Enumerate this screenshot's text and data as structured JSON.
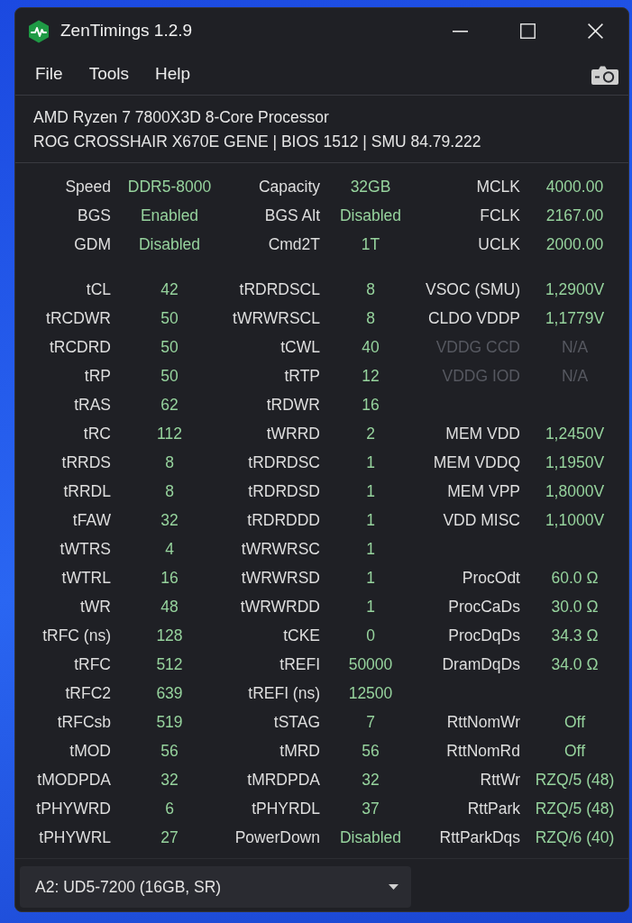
{
  "window": {
    "title": "ZenTimings 1.2.9"
  },
  "menu": [
    "File",
    "Tools",
    "Help"
  ],
  "system_info": {
    "processor": "AMD Ryzen 7 7800X3D 8-Core Processor",
    "board": "ROG CROSSHAIR X670E GENE | BIOS 1512 | SMU 84.79.222"
  },
  "sections": [
    {
      "rows": [
        [
          {
            "label": "Speed",
            "value": "DDR5-8000",
            "disabled": false
          },
          {
            "label": "Capacity",
            "value": "32GB",
            "disabled": false
          },
          {
            "label": "MCLK",
            "value": "4000.00",
            "disabled": false
          }
        ],
        [
          {
            "label": "BGS",
            "value": "Enabled",
            "disabled": false
          },
          {
            "label": "BGS Alt",
            "value": "Disabled",
            "disabled": false
          },
          {
            "label": "FCLK",
            "value": "2167.00",
            "disabled": false
          }
        ],
        [
          {
            "label": "GDM",
            "value": "Disabled",
            "disabled": false
          },
          {
            "label": "Cmd2T",
            "value": "1T",
            "disabled": false
          },
          {
            "label": "UCLK",
            "value": "2000.00",
            "disabled": false
          }
        ]
      ]
    },
    {
      "rows": [
        [
          {
            "label": "tCL",
            "value": "42",
            "disabled": false
          },
          {
            "label": "tRDRDSCL",
            "value": "8",
            "disabled": false
          },
          {
            "label": "VSOC (SMU)",
            "value": "1,2900V",
            "disabled": false
          }
        ],
        [
          {
            "label": "tRCDWR",
            "value": "50",
            "disabled": false
          },
          {
            "label": "tWRWRSCL",
            "value": "8",
            "disabled": false
          },
          {
            "label": "CLDO VDDP",
            "value": "1,1779V",
            "disabled": false
          }
        ],
        [
          {
            "label": "tRCDRD",
            "value": "50",
            "disabled": false
          },
          {
            "label": "tCWL",
            "value": "40",
            "disabled": false
          },
          {
            "label": "VDDG CCD",
            "value": "N/A",
            "disabled": true
          }
        ],
        [
          {
            "label": "tRP",
            "value": "50",
            "disabled": false
          },
          {
            "label": "tRTP",
            "value": "12",
            "disabled": false
          },
          {
            "label": "VDDG IOD",
            "value": "N/A",
            "disabled": true
          }
        ],
        [
          {
            "label": "tRAS",
            "value": "62",
            "disabled": false
          },
          {
            "label": "tRDWR",
            "value": "16",
            "disabled": false
          },
          null
        ],
        [
          {
            "label": "tRC",
            "value": "112",
            "disabled": false
          },
          {
            "label": "tWRRD",
            "value": "2",
            "disabled": false
          },
          {
            "label": "MEM VDD",
            "value": "1,2450V",
            "disabled": false
          }
        ],
        [
          {
            "label": "tRRDS",
            "value": "8",
            "disabled": false
          },
          {
            "label": "tRDRDSC",
            "value": "1",
            "disabled": false
          },
          {
            "label": "MEM VDDQ",
            "value": "1,1950V",
            "disabled": false
          }
        ],
        [
          {
            "label": "tRRDL",
            "value": "8",
            "disabled": false
          },
          {
            "label": "tRDRDSD",
            "value": "1",
            "disabled": false
          },
          {
            "label": "MEM VPP",
            "value": "1,8000V",
            "disabled": false
          }
        ],
        [
          {
            "label": "tFAW",
            "value": "32",
            "disabled": false
          },
          {
            "label": "tRDRDDD",
            "value": "1",
            "disabled": false
          },
          {
            "label": "VDD MISC",
            "value": "1,1000V",
            "disabled": false
          }
        ],
        [
          {
            "label": "tWTRS",
            "value": "4",
            "disabled": false
          },
          {
            "label": "tWRWRSC",
            "value": "1",
            "disabled": false
          },
          null
        ],
        [
          {
            "label": "tWTRL",
            "value": "16",
            "disabled": false
          },
          {
            "label": "tWRWRSD",
            "value": "1",
            "disabled": false
          },
          {
            "label": "ProcOdt",
            "value": "60.0 Ω",
            "disabled": false
          }
        ],
        [
          {
            "label": "tWR",
            "value": "48",
            "disabled": false
          },
          {
            "label": "tWRWRDD",
            "value": "1",
            "disabled": false
          },
          {
            "label": "ProcCaDs",
            "value": "30.0 Ω",
            "disabled": false
          }
        ],
        [
          {
            "label": "tRFC (ns)",
            "value": "128",
            "disabled": false
          },
          {
            "label": "tCKE",
            "value": "0",
            "disabled": false
          },
          {
            "label": "ProcDqDs",
            "value": "34.3 Ω",
            "disabled": false
          }
        ],
        [
          {
            "label": "tRFC",
            "value": "512",
            "disabled": false
          },
          {
            "label": "tREFI",
            "value": "50000",
            "disabled": false
          },
          {
            "label": "DramDqDs",
            "value": "34.0 Ω",
            "disabled": false
          }
        ],
        [
          {
            "label": "tRFC2",
            "value": "639",
            "disabled": false
          },
          {
            "label": "tREFI (ns)",
            "value": "12500",
            "disabled": false
          },
          null
        ],
        [
          {
            "label": "tRFCsb",
            "value": "519",
            "disabled": false
          },
          {
            "label": "tSTAG",
            "value": "7",
            "disabled": false
          },
          {
            "label": "RttNomWr",
            "value": "Off",
            "disabled": false
          }
        ],
        [
          {
            "label": "tMOD",
            "value": "56",
            "disabled": false
          },
          {
            "label": "tMRD",
            "value": "56",
            "disabled": false
          },
          {
            "label": "RttNomRd",
            "value": "Off",
            "disabled": false
          }
        ],
        [
          {
            "label": "tMODPDA",
            "value": "32",
            "disabled": false
          },
          {
            "label": "tMRDPDA",
            "value": "32",
            "disabled": false
          },
          {
            "label": "RttWr",
            "value": "RZQ/5 (48)",
            "disabled": false
          }
        ],
        [
          {
            "label": "tPHYWRD",
            "value": "6",
            "disabled": false
          },
          {
            "label": "tPHYRDL",
            "value": "37",
            "disabled": false
          },
          {
            "label": "RttPark",
            "value": "RZQ/5 (48)",
            "disabled": false
          }
        ],
        [
          {
            "label": "tPHYWRL",
            "value": "27",
            "disabled": false
          },
          {
            "label": "PowerDown",
            "value": "Disabled",
            "disabled": false
          },
          {
            "label": "RttParkDqs",
            "value": "RZQ/6 (40)",
            "disabled": false
          }
        ]
      ]
    }
  ],
  "module_selector": {
    "value": "A2: UD5-7200 (16GB, SR)"
  }
}
